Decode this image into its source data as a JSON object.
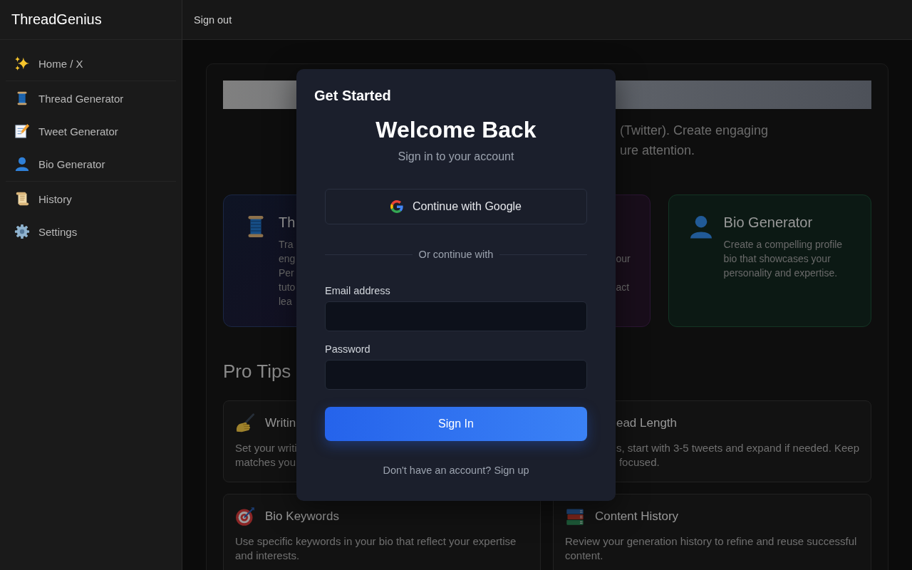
{
  "sidebar": {
    "brand": "ThreadGenius",
    "groups": [
      {
        "items": [
          {
            "label": "Home / X",
            "kind": "home"
          }
        ]
      },
      {
        "items": [
          {
            "label": "Thread Generator",
            "kind": "thread"
          },
          {
            "label": "Tweet Generator",
            "kind": "tweet"
          },
          {
            "label": "Bio Generator",
            "kind": "bio"
          }
        ]
      },
      {
        "items": [
          {
            "label": "History",
            "kind": "history"
          },
          {
            "label": "Settings",
            "kind": "settings"
          }
        ]
      }
    ]
  },
  "topbar": {
    "sign_out": "Sign out"
  },
  "main": {
    "intro_lines": [
      "(Twitter). Create engaging",
      "ure attention."
    ],
    "feature_cards": [
      {
        "kind": "thread",
        "title": "Th",
        "lines": [
          "Tra",
          "eng",
          "Per",
          "tuto",
          "lea"
        ]
      },
      {
        "kind": "tweet",
        "lines": [
          "our",
          "act"
        ]
      },
      {
        "kind": "bio",
        "title": "Bio Generator",
        "description": "Create a compelling profile bio that showcases your personality and expertise."
      }
    ],
    "pro_tips": {
      "heading": "Pro Tips",
      "cards": [
        {
          "kind": "writing",
          "title": "Writin",
          "lines": [
            "Set your writi",
            "matches you"
          ]
        },
        {
          "title": "ead Length",
          "lines": [
            "s, start with 3-5 tweets and expand if needed. Keep",
            "focused."
          ]
        },
        {
          "kind": "keywords",
          "title": "Bio Keywords",
          "description": "Use specific keywords in your bio that reflect your expertise and interests."
        },
        {
          "kind": "library",
          "title": "Content History",
          "description": "Review your generation history to refine and reuse successful content."
        }
      ]
    }
  },
  "modal": {
    "title": "Get Started",
    "heading": "Welcome Back",
    "subheading": "Sign in to your account",
    "google_button": "Continue with Google",
    "divider": "Or continue with",
    "fields": [
      {
        "label": "Email address"
      },
      {
        "label": "Password"
      }
    ],
    "submit": "Sign In",
    "signup_prompt": {
      "text": "Don't have an account?",
      "link": "Sign up"
    }
  }
}
